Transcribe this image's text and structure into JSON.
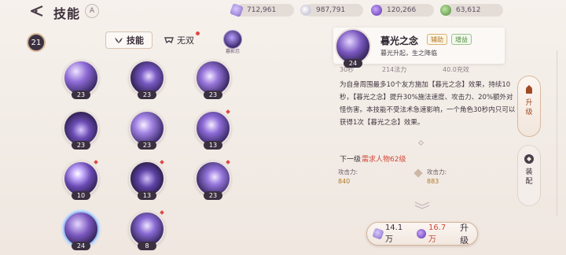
{
  "header": {
    "title": "技能",
    "title_tag": "A",
    "currencies": [
      {
        "icon": "purple-crystal-icon",
        "value": "712,961"
      },
      {
        "icon": "silver-coin-icon",
        "value": "987,791"
      },
      {
        "icon": "purple-gem-icon",
        "value": "120,266"
      },
      {
        "icon": "green-leaf-icon",
        "value": "63,612"
      }
    ]
  },
  "left": {
    "level_badge": "21",
    "tabs": [
      {
        "label": "技能",
        "icon": "wings-icon"
      },
      {
        "label": "无双",
        "icon": "mask-icon"
      }
    ],
    "mini_avatar_label": "暮影忍",
    "skills": [
      {
        "level": "23",
        "dot": false
      },
      {
        "level": "23",
        "dot": false
      },
      {
        "level": "23",
        "dot": false
      },
      {
        "level": "23",
        "dot": false
      },
      {
        "level": "23",
        "dot": false
      },
      {
        "level": "13",
        "dot": true
      },
      {
        "level": "10",
        "dot": true
      },
      {
        "level": "13",
        "dot": true
      },
      {
        "level": "23",
        "dot": true
      },
      {
        "level": "24",
        "dot": false
      },
      {
        "level": "8",
        "dot": true
      }
    ]
  },
  "detail": {
    "icon_level": "24",
    "name": "暮光之念",
    "tags": [
      "辅助",
      "增益"
    ],
    "subtitle": "暮光升起，生之降临",
    "stats": [
      "30秒",
      "214法力",
      "40.0充效"
    ],
    "description": "为自身周围最多10个友方施加【暮光之念】效果，持续10秒，【暮光之念】提升30%施法速度、攻击力、20%额外对怪伤害。本技能不受法术急速影响，一个角色30秒内只可以获得1次【暮光之念】效果。",
    "next_label": "下一级",
    "next_requirement": "需求人物62级",
    "attr_label_current": "攻击力:",
    "attr_value_current": "840",
    "attr_label_next": "攻击力:",
    "attr_value_next": "883"
  },
  "upgrade": {
    "cost1": "14.1万",
    "cost2": "16.7万",
    "label": "升级"
  },
  "side_tabs": [
    {
      "label_1": "升",
      "label_2": "级"
    },
    {
      "label_1": "装",
      "label_2": "配"
    }
  ],
  "colors": {
    "background": "#f3ede8",
    "accent_purple": "#7a58c0",
    "warning_red": "#d04838",
    "value_gold": "#b07a26"
  }
}
